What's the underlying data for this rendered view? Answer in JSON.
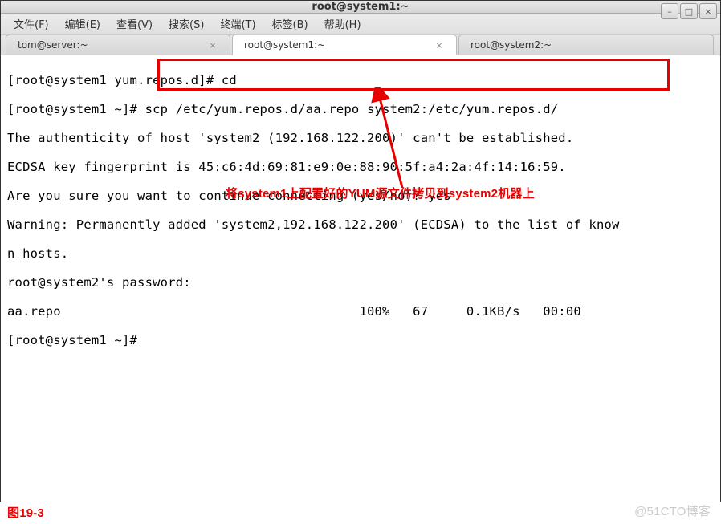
{
  "titlebar": {
    "title": "root@system1:~"
  },
  "window_controls": {
    "minimize": "–",
    "maximize": "□",
    "close": "×"
  },
  "menu": {
    "file": "文件(F)",
    "edit": "编辑(E)",
    "view": "查看(V)",
    "search": "搜索(S)",
    "terminal": "终端(T)",
    "tabs": "标签(B)",
    "help": "帮助(H)"
  },
  "tabs": {
    "tab1": "tom@server:~",
    "tab2": "root@system1:~",
    "tab3": "root@system2:~"
  },
  "terminal": {
    "line1": "[root@system1 yum.repos.d]# cd",
    "line2": "[root@system1 ~]# scp /etc/yum.repos.d/aa.repo system2:/etc/yum.repos.d/",
    "line3": "The authenticity of host 'system2 (192.168.122.200)' can't be established.",
    "line4": "ECDSA key fingerprint is 45:c6:4d:69:81:e9:0e:88:90:5f:a4:2a:4f:14:16:59.",
    "line5": "Are you sure you want to continue connecting (yes/no)? yes",
    "line6": "Warning: Permanently added 'system2,192.168.122.200' (ECDSA) to the list of know",
    "line7": "n hosts.",
    "line8": "root@system2's password: ",
    "line9": "aa.repo                                       100%   67     0.1KB/s   00:00    ",
    "line10": "[root@system1 ~]# "
  },
  "annotation": {
    "text": "将system1上配置好的YUM源文件拷贝到system2机器上",
    "figure_label": "图19-3"
  },
  "watermark": "@51CTO博客"
}
